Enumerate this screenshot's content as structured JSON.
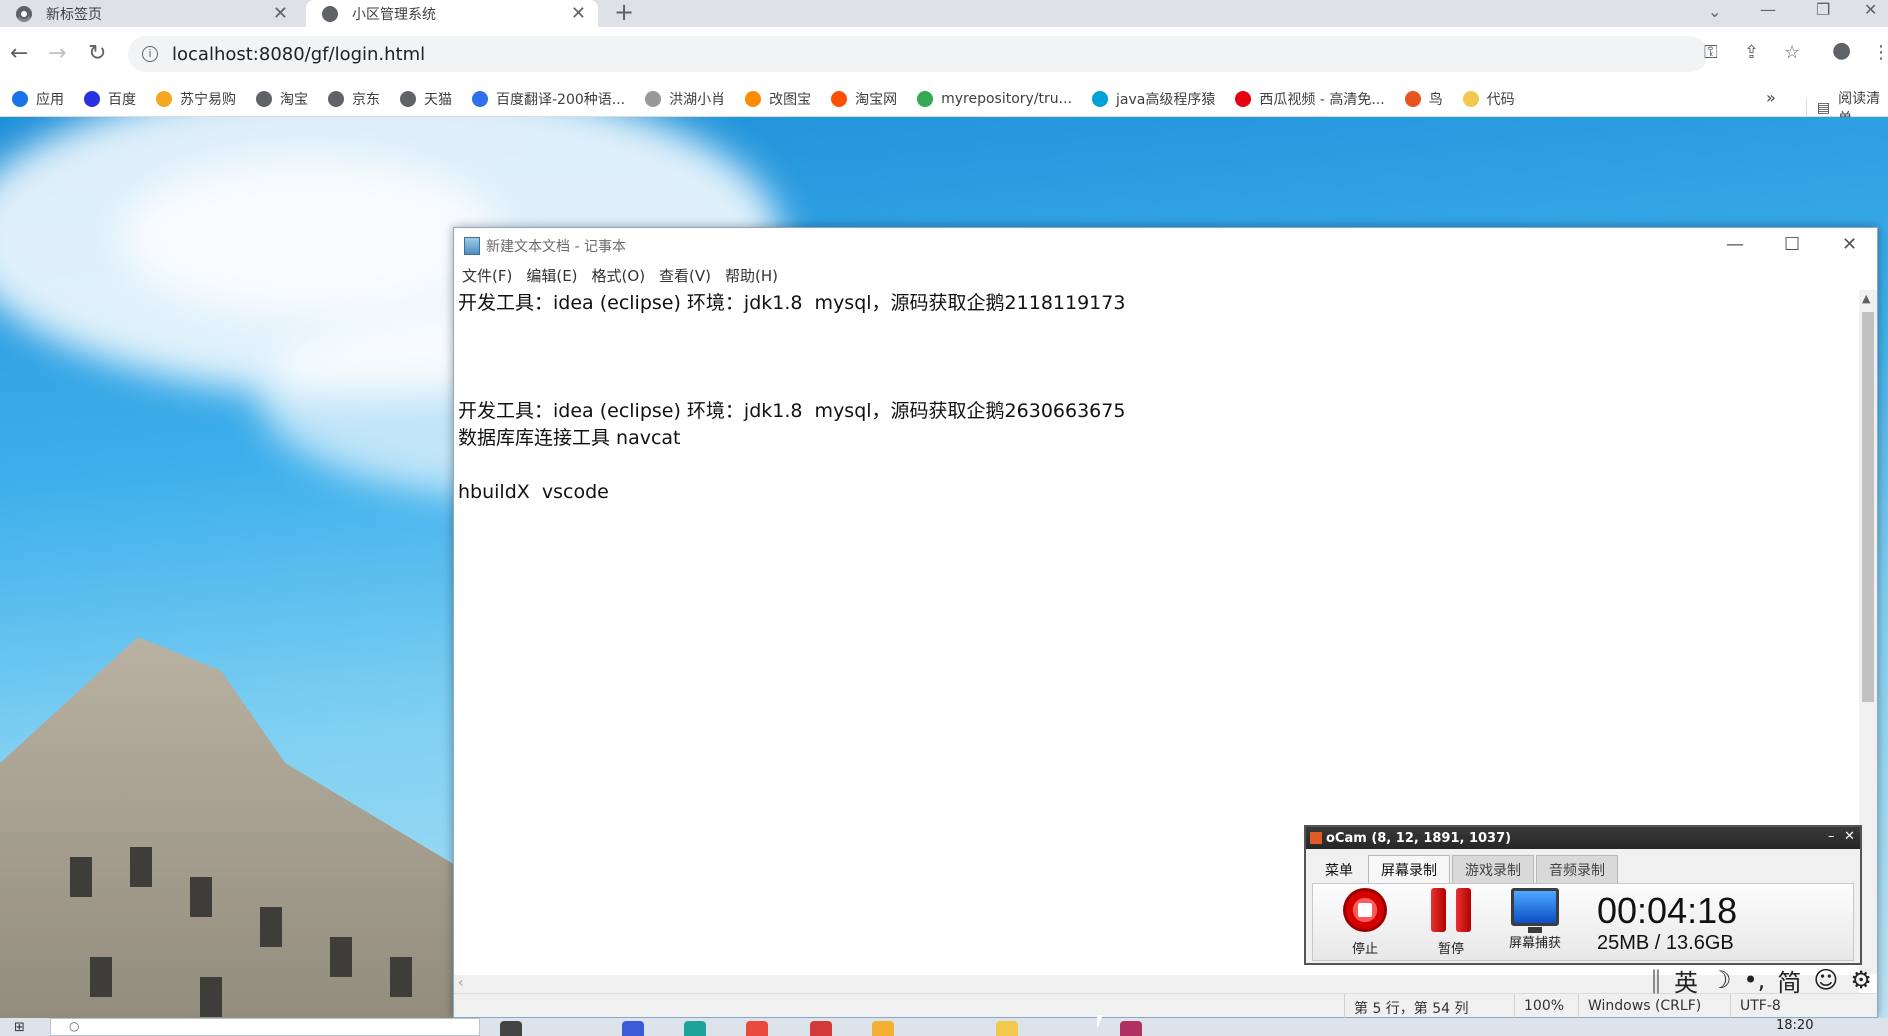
{
  "browser": {
    "tabs": [
      {
        "label": "新标签页"
      },
      {
        "label": "小区管理系统"
      }
    ],
    "url": "localhost:8080/gf/login.html",
    "bookmarks": [
      {
        "label": "应用",
        "color": "#1a73e8"
      },
      {
        "label": "百度",
        "color": "#2932e1"
      },
      {
        "label": "苏宁易购",
        "color": "#f5a623"
      },
      {
        "label": "淘宝",
        "color": "#5f6368"
      },
      {
        "label": "京东",
        "color": "#5f6368"
      },
      {
        "label": "天猫",
        "color": "#5f6368"
      },
      {
        "label": "百度翻译-200种语...",
        "color": "#2f6fea"
      },
      {
        "label": "洪湖小肖",
        "color": "#999999"
      },
      {
        "label": "改图宝",
        "color": "#ff8c00"
      },
      {
        "label": "淘宝网",
        "color": "#ff5000"
      },
      {
        "label": "myrepository/tru...",
        "color": "#34a853"
      },
      {
        "label": "java高级程序猿",
        "color": "#00a1d6"
      },
      {
        "label": "西瓜视频 - 高清免...",
        "color": "#e60012"
      },
      {
        "label": "鸟",
        "color": "#e8541e"
      },
      {
        "label": "代码",
        "color": "#f2c94c"
      }
    ],
    "more": "»",
    "reading_list": "阅读清单"
  },
  "notepad": {
    "title": "新建文本文档 - 记事本",
    "menu": [
      "文件(F)",
      "编辑(E)",
      "格式(O)",
      "查看(V)",
      "帮助(H)"
    ],
    "content": "开发工具：idea (eclipse) 环境：jdk1.8  mysql，源码获取企鹅2118119173\n\n\n\n开发工具：idea (eclipse) 环境：jdk1.8  mysql，源码获取企鹅2630663675\n数据库库连接工具 navcat\n\nhbuildX  vscode",
    "status": {
      "position": "第 5 行，第 54 列",
      "zoom": "100%",
      "line_ending": "Windows (CRLF)",
      "encoding": "UTF-8"
    }
  },
  "ocam": {
    "title": "oCam (8, 12, 1891, 1037)",
    "tabs": [
      "菜单",
      "屏幕录制",
      "游戏录制",
      "音频录制"
    ],
    "stop_label": "停止",
    "pause_label": "暂停",
    "capture_label": "屏幕捕获",
    "timer": "00:04:18",
    "size": "25MB / 13.6GB"
  },
  "ime": {
    "lang": "英",
    "mode": "简"
  },
  "taskbar": {
    "clock": "18:20"
  }
}
